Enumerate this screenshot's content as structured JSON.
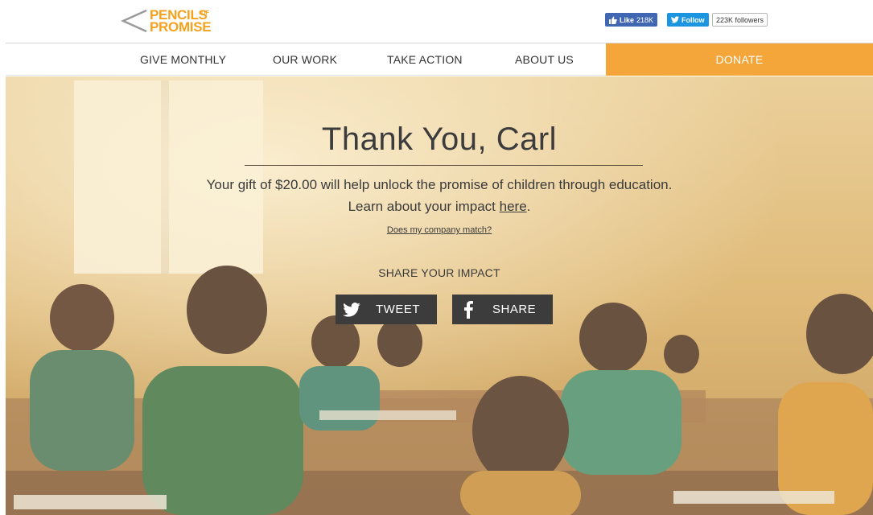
{
  "brand": {
    "logo_top": "PENCILS",
    "logo_or": "OF",
    "logo_bottom": "PROMISE",
    "accent": "#f4a21e"
  },
  "social": {
    "fb_like_label": "Like",
    "fb_like_count": "218K",
    "tw_follow_label": "Follow",
    "tw_followers": "223K followers"
  },
  "nav": {
    "items": [
      "GIVE MONTHLY",
      "OUR WORK",
      "TAKE ACTION",
      "ABOUT US"
    ],
    "donate": "DONATE",
    "donate_color": "#f4a63a"
  },
  "hero": {
    "title": "Thank You, Carl",
    "line1": "Your gift of $20.00 will help unlock the promise of children through education.",
    "line2_prefix": "Learn about your impact ",
    "line2_link": "here",
    "line2_suffix": ".",
    "match_link": "Does my company match?",
    "share_label": "SHARE YOUR IMPACT",
    "tweet": "TWEET",
    "share": "SHARE"
  },
  "icons": [
    "logo-chevron-icon",
    "thumbs-up-icon",
    "twitter-bird-icon",
    "facebook-f-icon"
  ]
}
